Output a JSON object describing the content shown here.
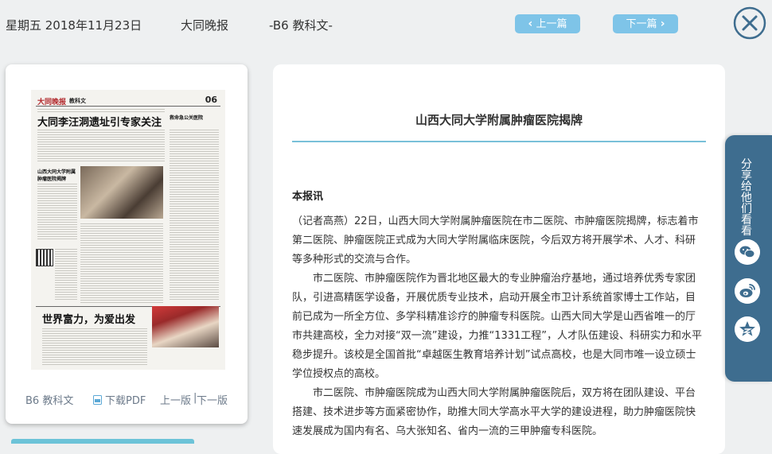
{
  "header": {
    "date": "星期五 2018年11月23日",
    "newspaper": "大同晚报",
    "page": "-B6 教科文-",
    "prev_label": "上一篇",
    "next_label": "下一篇"
  },
  "preview": {
    "masthead": "大同晚报",
    "section": "教科文",
    "page_no": "06",
    "headline": "大同李汪洞遗址引专家关注",
    "sidehead_1": "山西大同大学附属肿瘤医院揭牌",
    "sidehead_2": "救命急公关医院",
    "big_headline": "世界富力，为爱出发"
  },
  "left_footer": {
    "page": "B6 教科文",
    "download": "下载PDF",
    "prev_page": "上一版",
    "separator": "|",
    "next_page": "下一版"
  },
  "article": {
    "title": "山西大同大学附属肿瘤医院揭牌",
    "byline": "本报讯",
    "paragraphs": [
      "（记者高燕）22日，山西大同大学附属肿瘤医院在市二医院、市肿瘤医院揭牌，标志着市第二医院、肿瘤医院正式成为大同大学附属临床医院，今后双方将开展学术、人才、科研等多种形式的交流与合作。",
      "市二医院、市肿瘤医院作为晋北地区最大的专业肿瘤治疗基地，通过培养优秀专家团队，引进高精医学设备，开展优质专业技术，启动开展全市卫计系统首家博士工作站，目前已成为一所全方位、多学科精准诊疗的肿瘤专科医院。山西大同大学是山西省唯一的厅市共建高校，全力对接“双一流”建设，力推“1331工程”，人才队伍建设、科研实力和水平稳步提升。该校是全国首批“卓越医生教育培养计划”试点高校，也是大同市唯一设立硕士学位授权点的高校。",
      "市二医院、市肿瘤医院成为山西大同大学附属肿瘤医院后，双方将在团队建设、平台搭建、技术进步等方面紧密协作，助推大同大学高水平大学的建设进程，助力肿瘤医院快速发展成为国内有名、乌大张知名、省内一流的三甲肿瘤专科医院。"
    ]
  },
  "share": {
    "label": "分享给他们看看",
    "icons": [
      "wechat-icon",
      "weibo-icon",
      "qzone-icon"
    ]
  },
  "colors": {
    "accent": "#7ec4e8",
    "share_bg": "#3e6d8f",
    "title_rule": "#79c0d9",
    "close": "#3e6d8f"
  }
}
